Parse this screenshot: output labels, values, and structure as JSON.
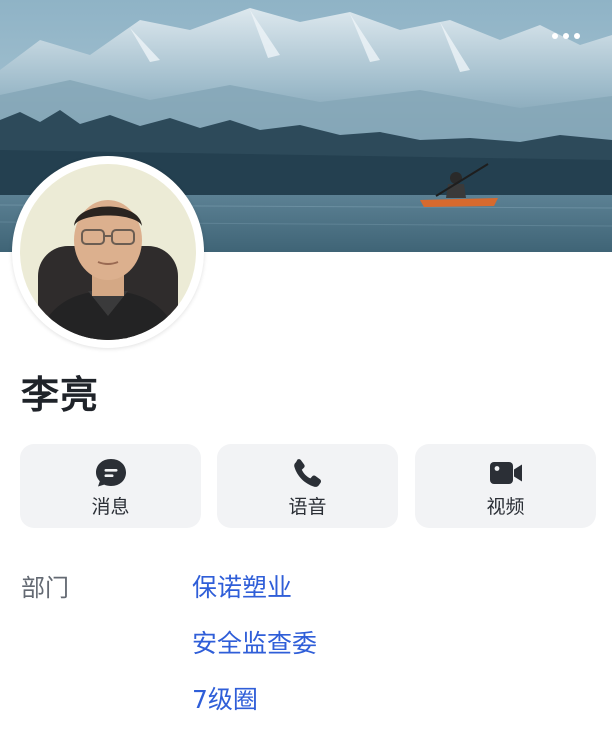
{
  "header": {
    "more_icon": "more-horizontal-icon",
    "banner_image": "mountain-lake-kayak-banner"
  },
  "profile": {
    "avatar": "avatar-photo",
    "name": "李亮"
  },
  "actions": [
    {
      "label": "消息",
      "icon": "message-icon"
    },
    {
      "label": "语音",
      "icon": "phone-icon"
    },
    {
      "label": "视频",
      "icon": "video-icon"
    }
  ],
  "department": {
    "label": "部门",
    "items": [
      "保诺塑业",
      "安全监查委",
      "7级圈"
    ]
  },
  "colors": {
    "link": "#2f5ed8",
    "button_bg": "#f2f3f5",
    "label_gray": "#646a73",
    "text": "#1f2329"
  }
}
